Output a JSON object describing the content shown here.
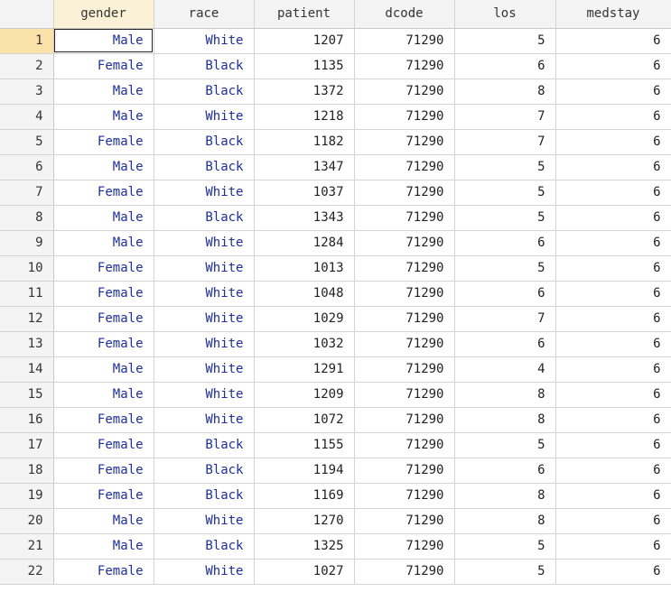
{
  "columns": [
    "gender",
    "race",
    "patient",
    "dcode",
    "los",
    "medstay"
  ],
  "selected_row": 1,
  "rows": [
    {
      "n": "1",
      "gender": "Male",
      "race": "White",
      "patient": "1207",
      "dcode": "71290",
      "los": "5",
      "medstay": "6"
    },
    {
      "n": "2",
      "gender": "Female",
      "race": "Black",
      "patient": "1135",
      "dcode": "71290",
      "los": "6",
      "medstay": "6"
    },
    {
      "n": "3",
      "gender": "Male",
      "race": "Black",
      "patient": "1372",
      "dcode": "71290",
      "los": "8",
      "medstay": "6"
    },
    {
      "n": "4",
      "gender": "Male",
      "race": "White",
      "patient": "1218",
      "dcode": "71290",
      "los": "7",
      "medstay": "6"
    },
    {
      "n": "5",
      "gender": "Female",
      "race": "Black",
      "patient": "1182",
      "dcode": "71290",
      "los": "7",
      "medstay": "6"
    },
    {
      "n": "6",
      "gender": "Male",
      "race": "Black",
      "patient": "1347",
      "dcode": "71290",
      "los": "5",
      "medstay": "6"
    },
    {
      "n": "7",
      "gender": "Female",
      "race": "White",
      "patient": "1037",
      "dcode": "71290",
      "los": "5",
      "medstay": "6"
    },
    {
      "n": "8",
      "gender": "Male",
      "race": "Black",
      "patient": "1343",
      "dcode": "71290",
      "los": "5",
      "medstay": "6"
    },
    {
      "n": "9",
      "gender": "Male",
      "race": "White",
      "patient": "1284",
      "dcode": "71290",
      "los": "6",
      "medstay": "6"
    },
    {
      "n": "10",
      "gender": "Female",
      "race": "White",
      "patient": "1013",
      "dcode": "71290",
      "los": "5",
      "medstay": "6"
    },
    {
      "n": "11",
      "gender": "Female",
      "race": "White",
      "patient": "1048",
      "dcode": "71290",
      "los": "6",
      "medstay": "6"
    },
    {
      "n": "12",
      "gender": "Female",
      "race": "White",
      "patient": "1029",
      "dcode": "71290",
      "los": "7",
      "medstay": "6"
    },
    {
      "n": "13",
      "gender": "Female",
      "race": "White",
      "patient": "1032",
      "dcode": "71290",
      "los": "6",
      "medstay": "6"
    },
    {
      "n": "14",
      "gender": "Male",
      "race": "White",
      "patient": "1291",
      "dcode": "71290",
      "los": "4",
      "medstay": "6"
    },
    {
      "n": "15",
      "gender": "Male",
      "race": "White",
      "patient": "1209",
      "dcode": "71290",
      "los": "8",
      "medstay": "6"
    },
    {
      "n": "16",
      "gender": "Female",
      "race": "White",
      "patient": "1072",
      "dcode": "71290",
      "los": "8",
      "medstay": "6"
    },
    {
      "n": "17",
      "gender": "Female",
      "race": "Black",
      "patient": "1155",
      "dcode": "71290",
      "los": "5",
      "medstay": "6"
    },
    {
      "n": "18",
      "gender": "Female",
      "race": "Black",
      "patient": "1194",
      "dcode": "71290",
      "los": "6",
      "medstay": "6"
    },
    {
      "n": "19",
      "gender": "Female",
      "race": "Black",
      "patient": "1169",
      "dcode": "71290",
      "los": "8",
      "medstay": "6"
    },
    {
      "n": "20",
      "gender": "Male",
      "race": "White",
      "patient": "1270",
      "dcode": "71290",
      "los": "8",
      "medstay": "6"
    },
    {
      "n": "21",
      "gender": "Male",
      "race": "Black",
      "patient": "1325",
      "dcode": "71290",
      "los": "5",
      "medstay": "6"
    },
    {
      "n": "22",
      "gender": "Female",
      "race": "White",
      "patient": "1027",
      "dcode": "71290",
      "los": "5",
      "medstay": "6"
    }
  ],
  "colors": {
    "string_text": "#1c2f9c",
    "numeric_text": "#222222",
    "header_bg": "#f4f4f4",
    "selected_header_bg": "#fbf1d7",
    "selected_rownum_bg": "#fbe2a8",
    "gridline": "#d4d4d4"
  }
}
